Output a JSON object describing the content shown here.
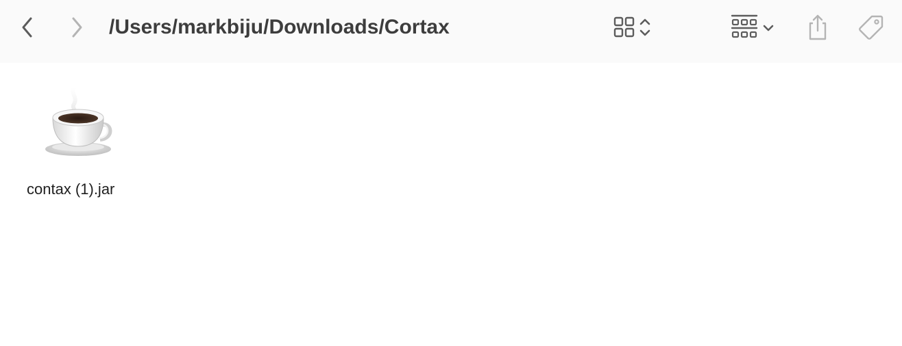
{
  "toolbar": {
    "back_icon": "chevron-left-icon",
    "forward_icon": "chevron-right-icon",
    "path": "/Users/markbiju/Downloads/Cortax",
    "view_mode_icon": "icon-grid-view-icon",
    "view_sort_icon": "chevron-up-down-icon",
    "group_icon": "group-by-grid-icon",
    "group_menu_icon": "chevron-down-icon",
    "share_icon": "share-icon",
    "tag_icon": "tag-icon"
  },
  "files": [
    {
      "name": "contax (1).jar",
      "icon": "java-coffee-cup-icon"
    }
  ],
  "colors": {
    "toolbar_bg": "#fafafa",
    "title_text": "#3d3d3d",
    "icon_active": "#5c5c5c",
    "icon_disabled": "#b4b4b4"
  }
}
